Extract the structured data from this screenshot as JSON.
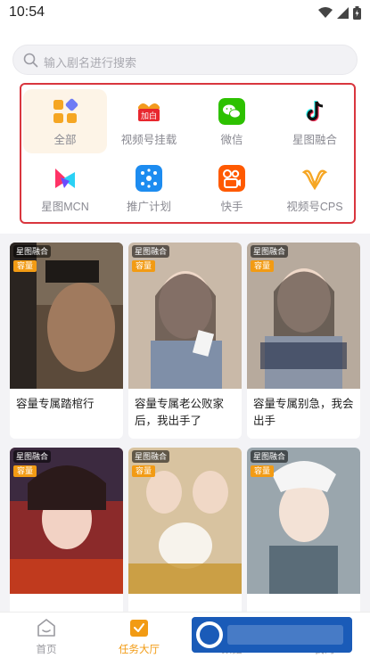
{
  "status_bar": {
    "time": "10:54"
  },
  "search": {
    "placeholder": "输入剧名进行搜索"
  },
  "categories": [
    {
      "label": "全部",
      "icon": "all-grid-icon",
      "active": true
    },
    {
      "label": "视频号挂载",
      "icon": "video-account-mount-icon",
      "active": false
    },
    {
      "label": "微信",
      "icon": "wechat-icon",
      "active": false
    },
    {
      "label": "星图融合",
      "icon": "tiktok-icon",
      "active": false
    },
    {
      "label": "星图MCN",
      "icon": "xingtu-mcn-icon",
      "active": false
    },
    {
      "label": "推广计划",
      "icon": "promotion-plan-icon",
      "active": false
    },
    {
      "label": "快手",
      "icon": "kuaishou-icon",
      "active": false
    },
    {
      "label": "视频号CPS",
      "icon": "video-account-cps-icon",
      "active": false
    }
  ],
  "cards": [
    {
      "platform_tag": "星图融合",
      "capacity_tag": "容量",
      "title": "容量专属踏棺行"
    },
    {
      "platform_tag": "星图融合",
      "capacity_tag": "容量",
      "title": "容量专属老公败家后，我出手了"
    },
    {
      "platform_tag": "星图融合",
      "capacity_tag": "容量",
      "title": "容量专属别急，我会出手"
    },
    {
      "platform_tag": "星图融合",
      "capacity_tag": "容量",
      "title": ""
    },
    {
      "platform_tag": "星图融合",
      "capacity_tag": "容量",
      "title": ""
    },
    {
      "platform_tag": "星图融合",
      "capacity_tag": "容量",
      "title": ""
    }
  ],
  "bottom_nav": [
    {
      "label": "首页",
      "icon": "home-icon",
      "active": false
    },
    {
      "label": "任务大厅",
      "icon": "task-hall-icon",
      "active": true
    },
    {
      "label": "数据",
      "icon": "data-icon",
      "active": false
    },
    {
      "label": "我的",
      "icon": "profile-icon",
      "active": false
    }
  ],
  "colors": {
    "accent": "#f29b14",
    "highlight_border": "#d9363e",
    "capacity_tag": "#f29b14"
  }
}
